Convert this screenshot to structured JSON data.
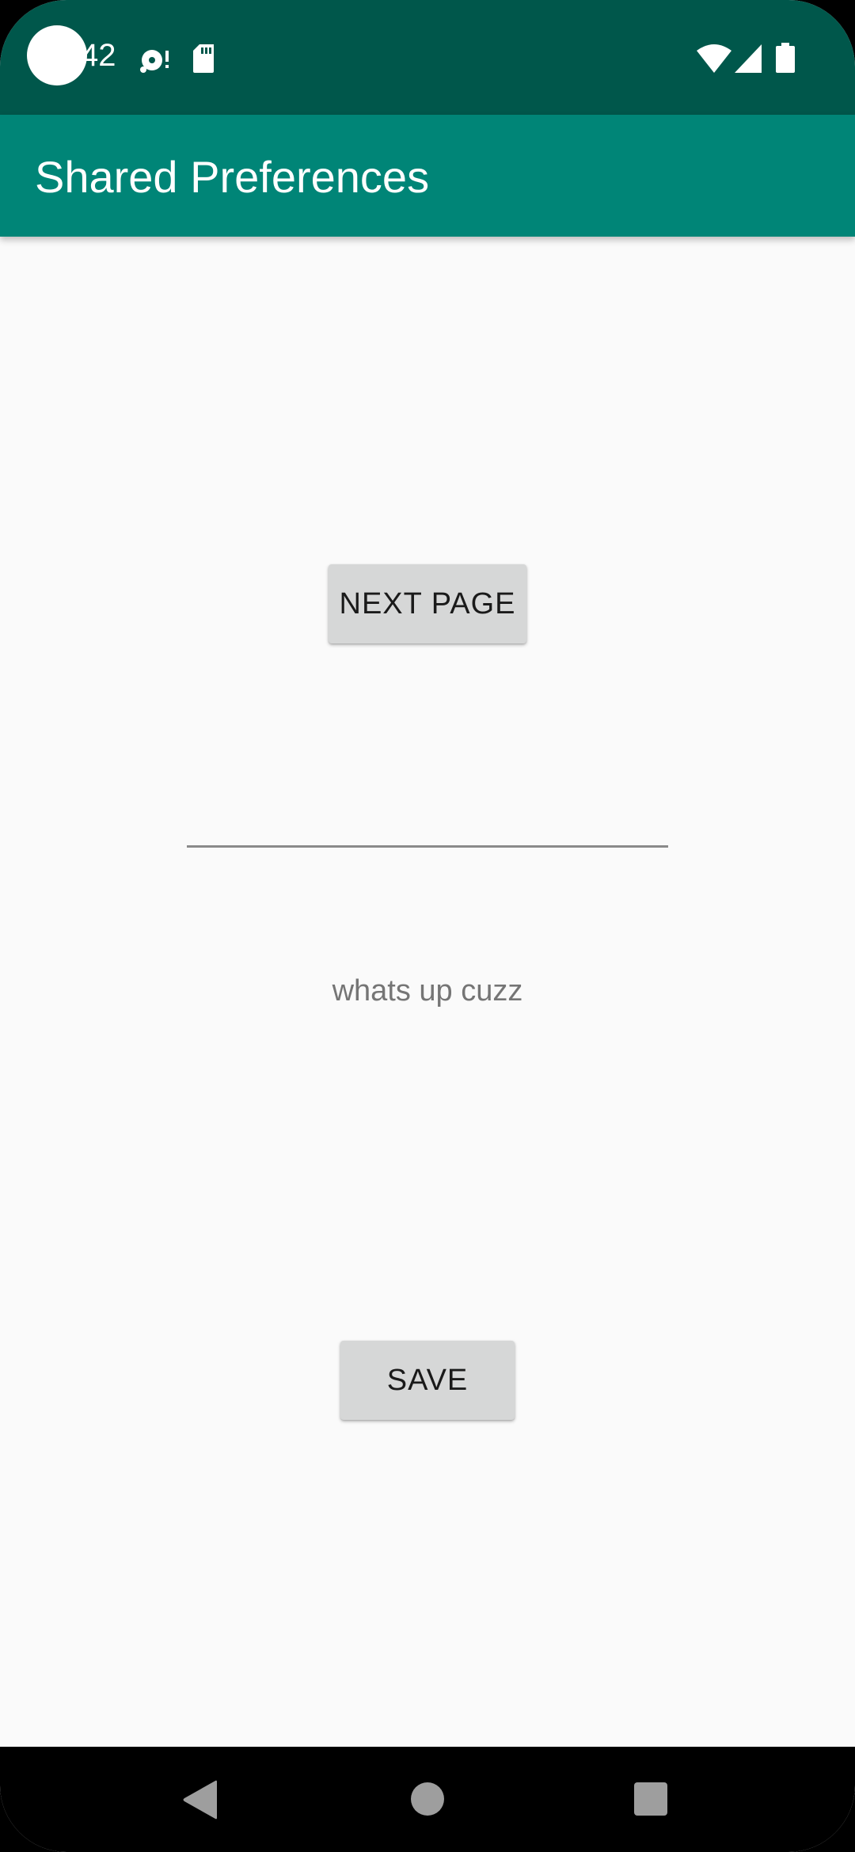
{
  "status_bar": {
    "time": "42",
    "background": "#00574b",
    "icons": [
      "camera-cutout-icon",
      "sync-disk-icon",
      "sd-card-icon",
      "wifi-icon",
      "cell-signal-icon",
      "battery-icon"
    ]
  },
  "app_bar": {
    "title": "Shared Preferences",
    "background": "#008577"
  },
  "main": {
    "next_page_label": "NEXT PAGE",
    "input_value": "",
    "saved_text": "whats up cuzz",
    "save_label": "SAVE"
  },
  "nav_bar": {
    "icons": [
      "back-icon",
      "home-icon",
      "recents-icon"
    ]
  }
}
